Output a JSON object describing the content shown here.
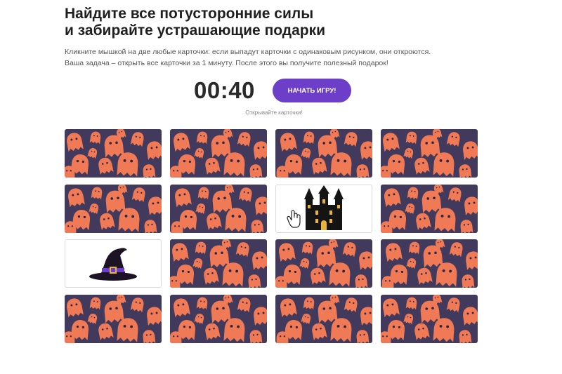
{
  "header": {
    "title_line1": "Найдите все потусторонние силы",
    "title_line2": "и забирайте устрашающие подарки"
  },
  "instructions": {
    "line1": "Кликните мышкой на две любые карточки: если выпадут карточки с одинаковым рисунком, они откроются.",
    "line2": "Ваша задача – открыть все карточки за 1 минуту. После этого вы получите полезный подарок!"
  },
  "game": {
    "timer": "00:40",
    "start_button_label": "НАЧАТЬ ИГРУ!",
    "hint": "Открывайте карточки!",
    "colors": {
      "card_back_bg": "#413a5c",
      "ghost": "#f07a55",
      "button": "#6d3ec7"
    },
    "cards": [
      "ghost-pattern",
      "ghost-pattern",
      "ghost-pattern",
      "ghost-pattern",
      "ghost-pattern",
      "ghost-pattern",
      "haunted-castle",
      "ghost-pattern",
      "witch-hat",
      "ghost-pattern",
      "ghost-pattern",
      "ghost-pattern",
      "ghost-pattern",
      "ghost-pattern",
      "ghost-pattern",
      "ghost-pattern"
    ]
  }
}
